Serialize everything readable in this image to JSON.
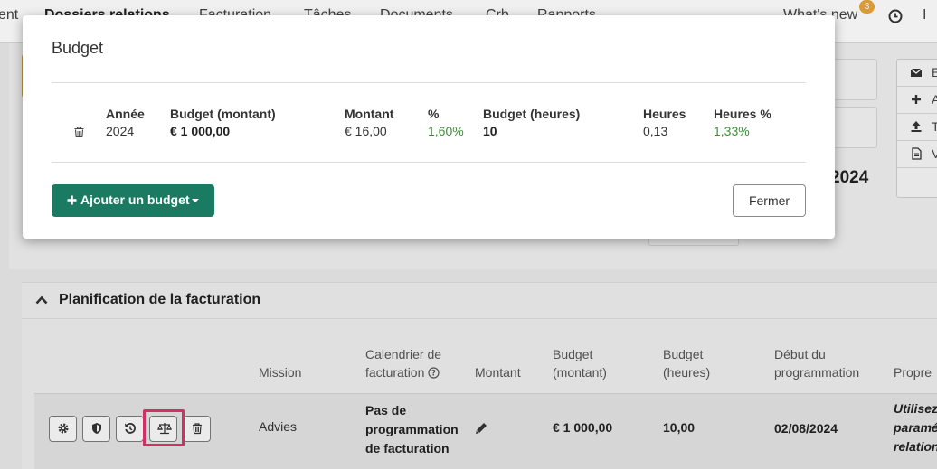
{
  "topnav": {
    "items": [
      "ent",
      "Dossiers relations",
      "Facturation",
      "Tâches",
      "Documents",
      "Crb",
      "Rapports"
    ],
    "whats_new": "What's new",
    "badge_count": "3",
    "right_partial": "I"
  },
  "side_actions": [
    {
      "icon": "envelope-icon",
      "letter": "E"
    },
    {
      "icon": "plus-icon",
      "letter": "A"
    },
    {
      "icon": "upload-icon",
      "letter": "T"
    },
    {
      "icon": "file-icon",
      "letter": "V"
    }
  ],
  "background_year": "2024",
  "planning": {
    "title": "Planification de la facturation",
    "columns": {
      "mission": "Mission",
      "calendar": "Calendrier de facturation",
      "amount": "Montant",
      "budget_amount": "Budget (montant)",
      "budget_hours": "Budget (heures)",
      "start": "Début du programmation",
      "own": "Propre"
    },
    "row": {
      "mission": "Advies",
      "calendar": "Pas de programmation de facturation",
      "budget_amount": "€ 1 000,00",
      "budget_hours": "10,00",
      "start": "02/08/2024",
      "own_line1": "Utilisez",
      "own_line2": "paramé",
      "own_line3": "relation"
    }
  },
  "modal": {
    "title": "Budget",
    "headers": {
      "year": "Année",
      "budget_amount": "Budget (montant)",
      "amount": "Montant",
      "percent": "%",
      "budget_hours": "Budget (heures)",
      "hours": "Heures",
      "hours_percent": "Heures %"
    },
    "row": {
      "year": "2024",
      "budget_amount": "€ 1 000,00",
      "amount": "€ 16,00",
      "percent": "1,60%",
      "budget_hours": "10",
      "hours": "0,13",
      "hours_percent": "1,33%"
    },
    "add_button": "Ajouter un budget",
    "close_button": "Fermer"
  },
  "colors": {
    "primary": "#1b7b62",
    "positive": "#3f8f3a",
    "highlight": "#e0336b"
  }
}
